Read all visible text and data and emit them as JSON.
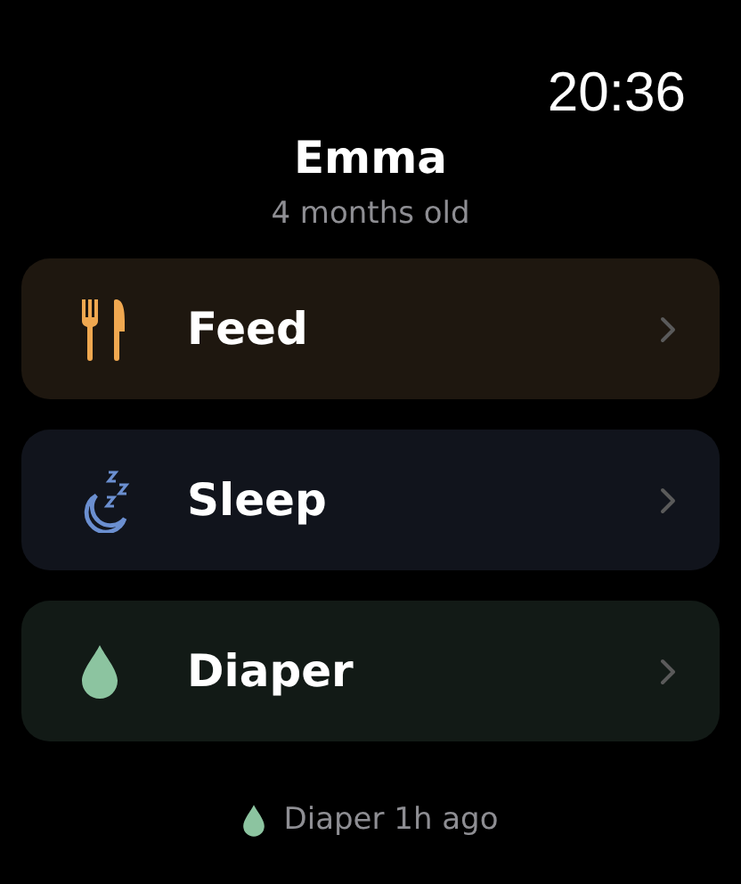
{
  "status_bar": {
    "time": "20:36"
  },
  "header": {
    "title": "Emma",
    "subtitle": "4 months old"
  },
  "actions": [
    {
      "kind": "feed",
      "label": "Feed",
      "color": "#f0a850"
    },
    {
      "kind": "sleep",
      "label": "Sleep",
      "color": "#6b8fd0"
    },
    {
      "kind": "diaper",
      "label": "Diaper",
      "color": "#8cc4a0"
    }
  ],
  "last_event": {
    "kind": "diaper",
    "color": "#8cc4a0",
    "text": "Diaper 1h ago"
  }
}
